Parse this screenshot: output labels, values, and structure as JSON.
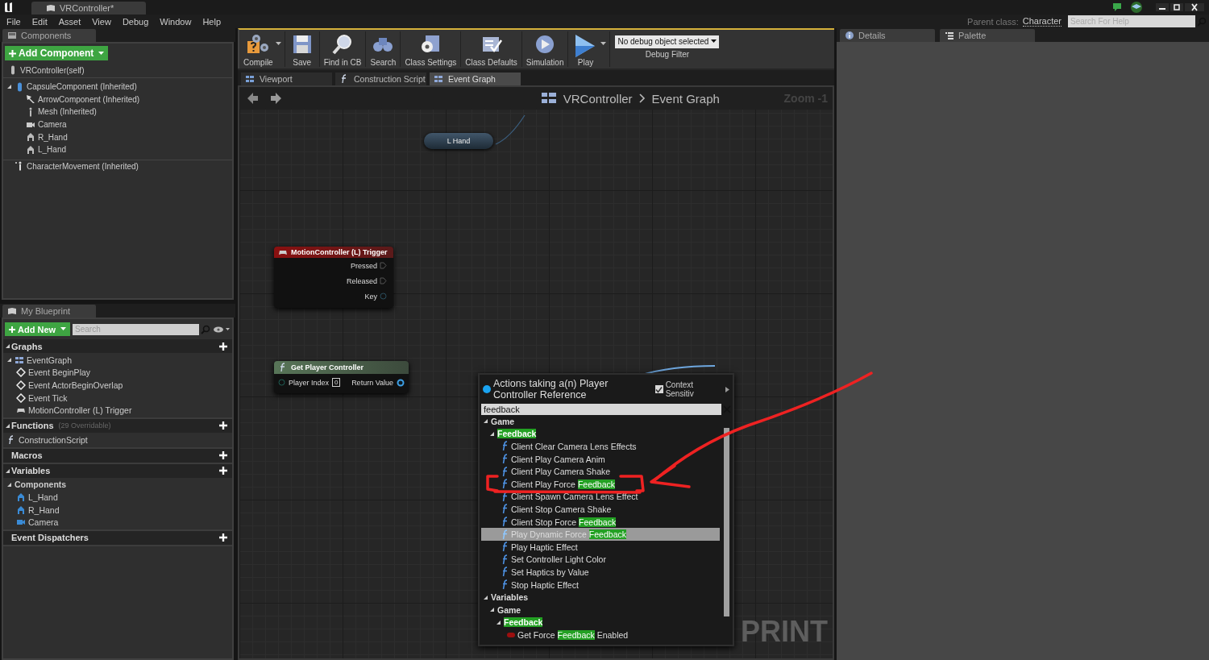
{
  "app_tab": {
    "title": "VRController*"
  },
  "menu": [
    "File",
    "Edit",
    "Asset",
    "View",
    "Debug",
    "Window",
    "Help"
  ],
  "parent_class": {
    "label": "Parent class:",
    "value": "Character"
  },
  "help_search": {
    "placeholder": "Search For Help"
  },
  "components_panel": {
    "tab": "Components",
    "add_button": "Add Component",
    "self_item": "VRController(self)",
    "tree": [
      {
        "label": "CapsuleComponent (Inherited)",
        "kind": "capsule",
        "expanded": true,
        "children": [
          {
            "label": "ArrowComponent (Inherited)",
            "kind": "arrow"
          },
          {
            "label": "Mesh (Inherited)",
            "kind": "mesh"
          },
          {
            "label": "Camera",
            "kind": "camera"
          },
          {
            "label": "R_Hand",
            "kind": "hand"
          },
          {
            "label": "L_Hand",
            "kind": "hand"
          }
        ]
      },
      {
        "label": "CharacterMovement (Inherited)",
        "kind": "movement"
      }
    ]
  },
  "blueprint_panel": {
    "tab": "My Blueprint",
    "add_button": "Add New",
    "search": {
      "placeholder": "Search"
    },
    "sections": [
      {
        "title": "Graphs",
        "add": true,
        "expanded": true,
        "items": [
          {
            "label": "EventGraph",
            "kind": "graph",
            "expanded": true,
            "children": [
              {
                "label": "Event BeginPlay",
                "kind": "event"
              },
              {
                "label": "Event ActorBeginOverlap",
                "kind": "event"
              },
              {
                "label": "Event Tick",
                "kind": "event"
              },
              {
                "label": "MotionController (L) Trigger",
                "kind": "input"
              }
            ]
          }
        ]
      },
      {
        "title": "Functions",
        "note": "(29 Overridable)",
        "add": true,
        "expanded": true,
        "items": [
          {
            "label": "ConstructionScript",
            "kind": "function"
          }
        ]
      },
      {
        "title": "Macros",
        "add": true
      },
      {
        "title": "Variables",
        "add": true,
        "expanded": true,
        "items": [
          {
            "label": "Components",
            "kind": "category",
            "expanded": true,
            "children": [
              {
                "label": "L_Hand",
                "kind": "hand"
              },
              {
                "label": "R_Hand",
                "kind": "hand"
              },
              {
                "label": "Camera",
                "kind": "camera"
              }
            ]
          }
        ]
      },
      {
        "title": "Event Dispatchers",
        "add": true
      }
    ]
  },
  "toolbar": [
    {
      "label": "Compile",
      "kind": "compile",
      "menu": true
    },
    {
      "label": "Save",
      "kind": "save"
    },
    {
      "label": "Find in CB",
      "kind": "find"
    },
    {
      "label": "Search",
      "kind": "binoculars"
    },
    {
      "label": "Class Settings",
      "kind": "settings"
    },
    {
      "label": "Class Defaults",
      "kind": "defaults"
    },
    {
      "label": "Simulation",
      "kind": "simulation"
    },
    {
      "label": "Play",
      "kind": "play",
      "menu": true
    }
  ],
  "debug_filter": {
    "value": "No debug object selected",
    "label": "Debug Filter"
  },
  "editor_tabs": [
    {
      "label": "Viewport",
      "kind": "viewport",
      "selected": false
    },
    {
      "label": "Construction Script",
      "kind": "function",
      "selected": false
    },
    {
      "label": "Event Graph",
      "kind": "graph",
      "selected": true
    }
  ],
  "graph": {
    "breadcrumb": [
      "VRController",
      "Event Graph"
    ],
    "zoom": "Zoom -1",
    "watermark": "PRINT",
    "nodes": [
      {
        "kind": "variable",
        "title": "L Hand"
      },
      {
        "kind": "event",
        "title": "MotionController (L) Trigger",
        "pins": [
          {
            "label": "Pressed",
            "kind": "exec"
          },
          {
            "label": "Released",
            "kind": "exec"
          },
          {
            "label": "Key",
            "kind": "data"
          }
        ]
      },
      {
        "kind": "function",
        "title": "Get Player Controller",
        "input": {
          "label": "Player Index",
          "value": "0"
        },
        "output": {
          "label": "Return Value"
        }
      }
    ]
  },
  "action_menu": {
    "title": "Actions taking a(n) Player Controller Reference",
    "context_sensitive": {
      "label": "Context Sensitiv",
      "checked": true
    },
    "search": "feedback",
    "items": [
      {
        "label": "Game",
        "kind": "category",
        "expanded": true,
        "children": [
          {
            "match": "Feedback",
            "kind": "category",
            "expanded": true,
            "children": [
              {
                "label": "Client Clear Camera Lens Effects",
                "kind": "function",
                "selected": false
              },
              {
                "label": "Client Play Camera Anim",
                "kind": "function",
                "selected": false
              },
              {
                "label": "Client Play Camera Shake",
                "kind": "function",
                "selected": false
              },
              {
                "label": "Client Play Force ",
                "match": "Feedback",
                "kind": "function",
                "selected": false
              },
              {
                "label": "Client Spawn Camera Lens Effect",
                "kind": "function",
                "selected": false
              },
              {
                "label": "Client Stop Camera Shake",
                "kind": "function",
                "selected": false
              },
              {
                "label": "Client Stop Force ",
                "match": "Feedback",
                "kind": "function",
                "selected": false
              },
              {
                "label": "Play Dynamic Force ",
                "match": "Feedback",
                "kind": "function",
                "selected": true
              },
              {
                "label": "Play Haptic Effect",
                "kind": "function",
                "selected": false
              },
              {
                "label": "Set Controller Light Color",
                "kind": "function",
                "selected": false
              },
              {
                "label": "Set Haptics by Value",
                "kind": "function",
                "selected": false
              },
              {
                "label": "Stop Haptic Effect",
                "kind": "function",
                "selected": false
              }
            ]
          }
        ]
      },
      {
        "label": "Variables",
        "kind": "category",
        "expanded": true,
        "children": [
          {
            "label": "Game",
            "kind": "category",
            "expanded": true,
            "children": [
              {
                "match": "Feedback",
                "kind": "category",
                "expanded": true,
                "children": [
                  {
                    "label": "Get Force ",
                    "match": "Feedback",
                    "after": " Enabled",
                    "kind": "variable",
                    "selected": false
                  }
                ]
              }
            ]
          }
        ]
      }
    ]
  },
  "side_tabs": [
    {
      "label": "Details",
      "kind": "details"
    },
    {
      "label": "Palette",
      "kind": "palette"
    }
  ]
}
